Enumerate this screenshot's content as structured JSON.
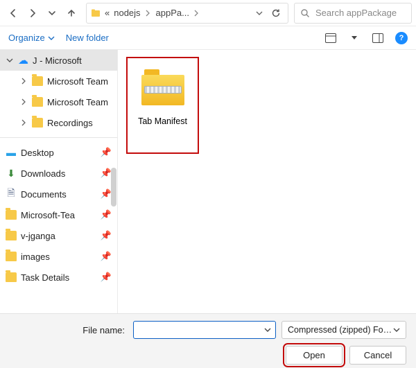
{
  "nav": {
    "breadcrumb": {
      "prefix": "«",
      "parts": [
        "nodejs",
        "appPa..."
      ]
    },
    "search_placeholder": "Search appPackage"
  },
  "toolbar": {
    "organize": "Organize",
    "new_folder": "New folder"
  },
  "sidebar": {
    "root": "J - Microsoft",
    "children": [
      "Microsoft Team",
      "Microsoft Team",
      "Recordings"
    ],
    "quick": [
      "Desktop",
      "Downloads",
      "Documents",
      "Microsoft-Tea",
      "v-jganga",
      "images",
      "Task Details"
    ]
  },
  "content": {
    "file_name": "Tab Manifest"
  },
  "footer": {
    "file_name_label": "File name:",
    "file_name_value": "",
    "filter": "Compressed (zipped) Folder",
    "open": "Open",
    "cancel": "Cancel"
  }
}
